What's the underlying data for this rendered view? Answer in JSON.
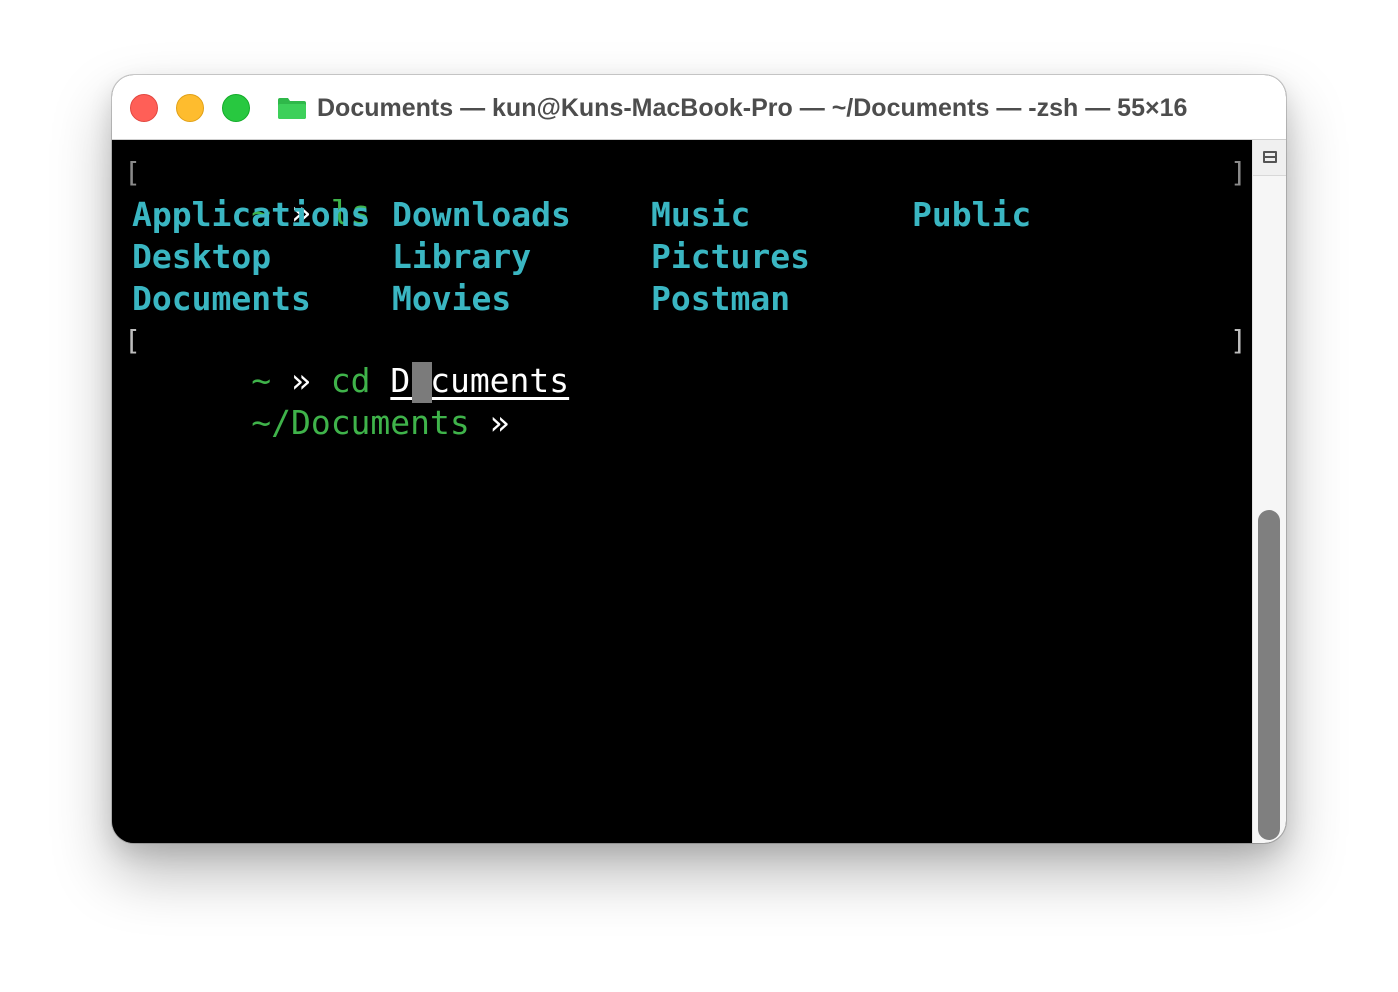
{
  "window": {
    "title": "Documents — kun@Kuns-MacBook-Pro — ~/Documents — -zsh — 55×16",
    "title_icon": "folder-icon",
    "traffic_lights": [
      "close",
      "minimize",
      "zoom"
    ]
  },
  "terminal": {
    "line1": {
      "prompt": "~",
      "sep": "»",
      "command": "ls"
    },
    "ls_output": [
      "Applications",
      "Downloads",
      "Music",
      "Public",
      "Desktop",
      "Library",
      "Pictures",
      "Documents",
      "Movies",
      "Postman"
    ],
    "line2": {
      "prompt": "~",
      "sep": "»",
      "command": "cd",
      "argument": "Documents"
    },
    "line3": {
      "prompt": "~/Documents",
      "sep": "»"
    },
    "bracket_left": "[",
    "bracket_right": "]"
  },
  "colors": {
    "prompt_green": "#3fb34a",
    "directory_cyan": "#3ab6c2",
    "background": "#000000"
  }
}
